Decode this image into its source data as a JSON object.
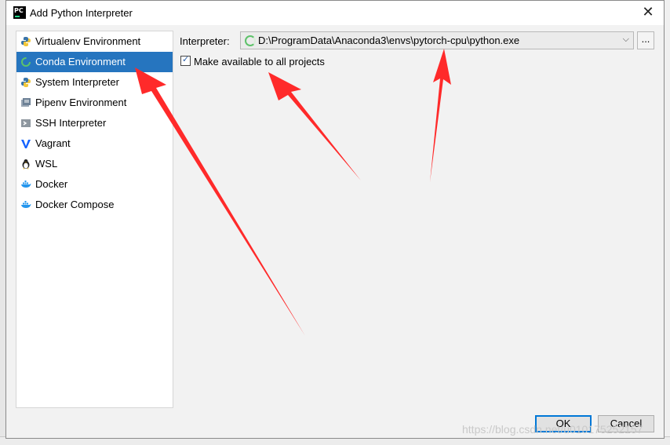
{
  "window": {
    "title": "Add Python Interpreter",
    "app_icon_text": "PC",
    "close_glyph": "✕"
  },
  "sidebar": {
    "items": [
      {
        "label": "Virtualenv Environment",
        "icon": "python-icon",
        "selected": false
      },
      {
        "label": "Conda Environment",
        "icon": "conda-icon",
        "selected": true
      },
      {
        "label": "System Interpreter",
        "icon": "python-icon",
        "selected": false
      },
      {
        "label": "Pipenv Environment",
        "icon": "pipenv-icon",
        "selected": false
      },
      {
        "label": "SSH Interpreter",
        "icon": "ssh-icon",
        "selected": false
      },
      {
        "label": "Vagrant",
        "icon": "vagrant-icon",
        "selected": false
      },
      {
        "label": "WSL",
        "icon": "linux-penguin-icon",
        "selected": false
      },
      {
        "label": "Docker",
        "icon": "docker-icon",
        "selected": false
      },
      {
        "label": "Docker Compose",
        "icon": "docker-icon",
        "selected": false
      }
    ]
  },
  "main": {
    "interpreter_label": "Interpreter:",
    "interpreter_value": "D:\\ProgramData\\Anaconda3\\envs\\pytorch-cpu\\python.exe",
    "browse_label": "...",
    "dropdown_glyph": "⌵",
    "make_available_label": "Make available to all projects",
    "make_available_checked": true
  },
  "footer": {
    "ok_label": "OK",
    "cancel_label": "Cancel"
  },
  "watermark": "https://blog.csdn.net/u010175252157",
  "colors": {
    "selection": "#2675bf",
    "arrow": "#ff2a2a",
    "ok_border": "#0078d7"
  }
}
